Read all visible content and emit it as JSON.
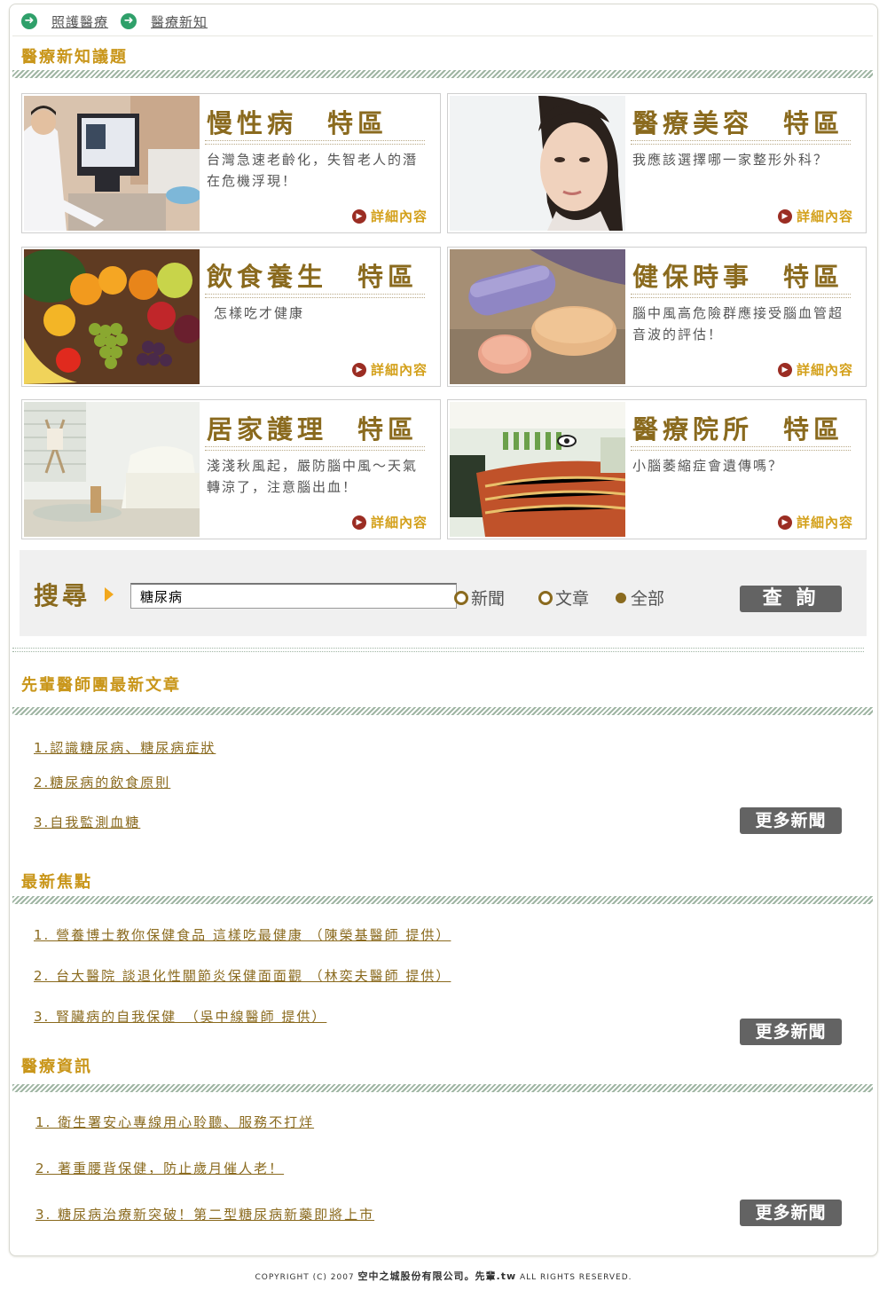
{
  "breadcrumb": [
    "照護醫療",
    "醫療新知"
  ],
  "section_topics": "醫療新知議題",
  "cards": [
    {
      "title": "慢性病　特區",
      "desc": "台灣急速老齡化，失智老人的潛在危機浮現！",
      "more": "詳細內容"
    },
    {
      "title": "醫療美容　特區",
      "desc": "我應該選擇哪一家整形外科？",
      "more": "詳細內容"
    },
    {
      "title": "飲食養生　特區",
      "desc": "怎樣吃才健康",
      "more": "詳細內容"
    },
    {
      "title": "健保時事　特區",
      "desc": "腦中風高危險群應接受腦血管超音波的評估！",
      "more": "詳細內容"
    },
    {
      "title": "居家護理　特區",
      "desc": "淺淺秋風起，嚴防腦中風～天氣轉涼了，注意腦出血！",
      "more": "詳細內容"
    },
    {
      "title": "醫療院所　特區",
      "desc": "小腦萎縮症會遺傳嗎？",
      "more": "詳細內容"
    }
  ],
  "search": {
    "label": "搜尋",
    "value": "糖尿病",
    "options": [
      "新聞",
      "文章",
      "全部"
    ],
    "selected": "全部",
    "button": "查 詢"
  },
  "doctors": {
    "title": "先輩醫師團最新文章",
    "items": [
      "1.認識糖尿病、糖尿病症狀",
      "2.糖尿病的飲食原則",
      "3.自我監測血糖"
    ],
    "more": "更多新聞"
  },
  "focus": {
    "title": "最新焦點",
    "items": [
      "1. 營養博士教你保健食品 這樣吃最健康 （陳榮基醫師 提供）",
      "2. 台大醫院 談退化性關節炎保健面面觀 （林奕夫醫師 提供）",
      "3. 腎臟病的自我保健　（吳中線醫師 提供）"
    ],
    "more": "更多新聞"
  },
  "info": {
    "title": "醫療資訊",
    "items": [
      "1. 衛生署安心專線用心聆聽、服務不打烊",
      "2. 著重腰背保健，防止歲月催人老！",
      "3. 糖尿病治療新突破！第二型糖尿病新藥即將上市"
    ],
    "more": "更多新聞"
  },
  "footer": {
    "prefix": "COPYRIGHT (C) 2007",
    "company": "空中之城股份有限公司。先輩.tw",
    "suffix": "ALL RIGHTS RESERVED."
  }
}
